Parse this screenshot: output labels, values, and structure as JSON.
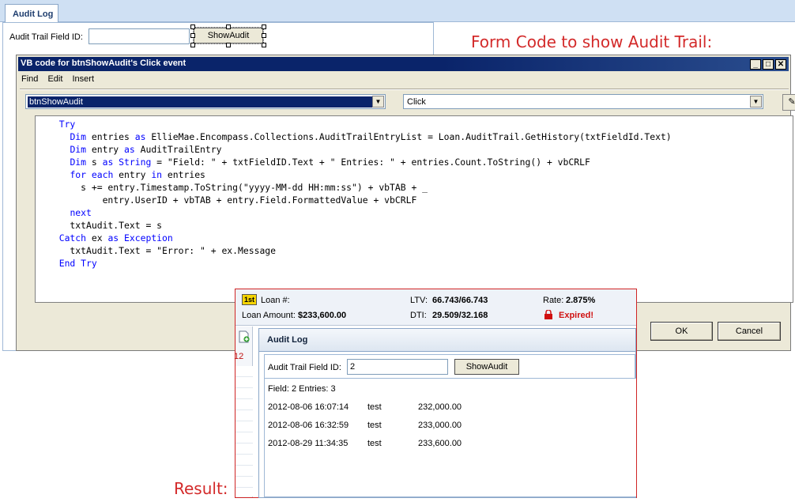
{
  "designer": {
    "tab_label": "Audit Log",
    "field_label": "Audit Trail Field ID:",
    "show_button_label": "ShowAudit"
  },
  "annotations": {
    "form_code_heading": "Form Code to show Audit Trail:",
    "result_heading": "Result:"
  },
  "vb_window": {
    "title": "VB code for btnShowAudit's Click event",
    "menu": [
      "Find",
      "Edit",
      "Insert"
    ],
    "object_combo": "btnShowAudit",
    "event_combo": "Click",
    "code_lines": [
      "  Try",
      "    Dim entries as EllieMae.Encompass.Collections.AuditTrailEntryList = Loan.AuditTrail.GetHistory(txtFieldId.Text)",
      "    Dim entry as AuditTrailEntry",
      "    Dim s as String = \"Field: \" + txtFieldID.Text + \" Entries: \" + entries.Count.ToString() + vbCRLF",
      "    for each entry in entries",
      "      s += entry.Timestamp.ToString(\"yyyy-MM-dd HH:mm:ss\") + vbTAB + _",
      "          entry.UserID + vbTAB + entry.Field.FormattedValue + vbCRLF",
      "    next",
      "    txtAudit.Text = s",
      "  Catch ex as Exception",
      "    txtAudit.Text = \"Error: \" + ex.Message",
      "  End Try"
    ],
    "ok_label": "OK",
    "cancel_label": "Cancel"
  },
  "loan_bar": {
    "badge": "1st",
    "loan_num_label": "Loan #:",
    "loan_amount_label": "Loan Amount:",
    "loan_amount_value": "$233,600.00",
    "ltv_label": "LTV:",
    "ltv_value": "66.743/66.743",
    "dti_label": "DTI:",
    "dti_value": "29.509/32.168",
    "rate_label": "Rate:",
    "rate_value": "2.875%",
    "lock_status": "Expired!"
  },
  "result_panel": {
    "rail_number": "12",
    "title": "Audit Log",
    "field_label": "Audit Trail Field ID:",
    "field_value": "2",
    "show_button_label": "ShowAudit",
    "summary": "Field: 2 Entries: 3",
    "entries": [
      {
        "timestamp": "2012-08-06 16:07:14",
        "user": "test",
        "value": "232,000.00"
      },
      {
        "timestamp": "2012-08-06 16:32:59",
        "user": "test",
        "value": "233,000.00"
      },
      {
        "timestamp": "2012-08-29 11:34:35",
        "user": "test",
        "value": "233,600.00"
      }
    ]
  }
}
